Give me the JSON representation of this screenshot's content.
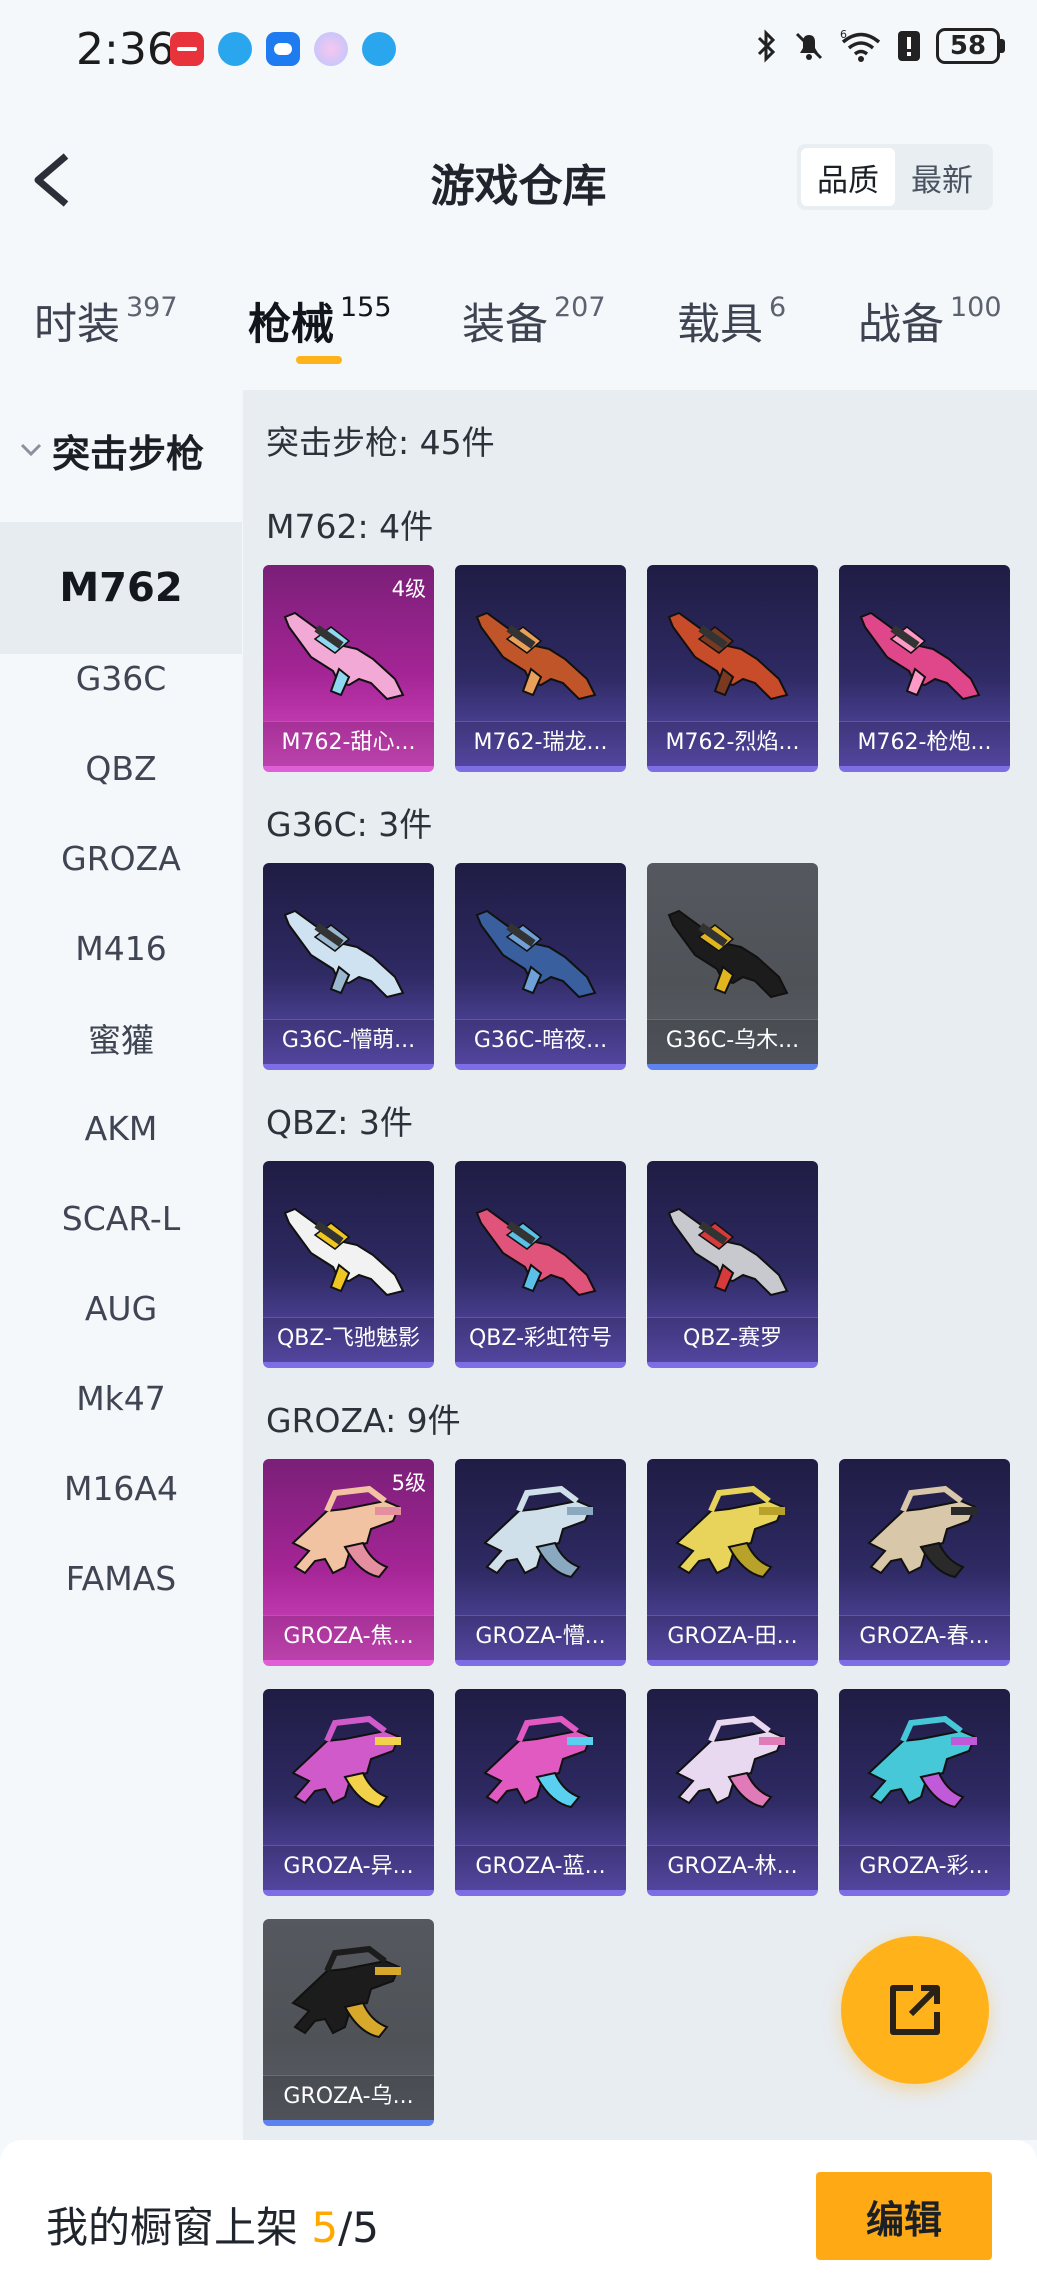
{
  "status_bar": {
    "time": "2:36",
    "battery": "58",
    "app_icons": [
      "huawei-store-icon",
      "browser-icon",
      "weather-icon",
      "assistant-icon",
      "browser-icon"
    ]
  },
  "header": {
    "title": "游戏仓库",
    "sort_options": [
      "品质",
      "最新"
    ],
    "sort_active": "品质"
  },
  "tabs": [
    {
      "label": "时装",
      "count": "397"
    },
    {
      "label": "枪械",
      "count": "155",
      "active": true
    },
    {
      "label": "装备",
      "count": "207"
    },
    {
      "label": "载具",
      "count": "6"
    },
    {
      "label": "战备",
      "count": "100"
    }
  ],
  "sidebar": {
    "group": "突击步枪",
    "items": [
      "M762",
      "G36C",
      "QBZ",
      "GROZA",
      "M416",
      "蜜獾",
      "AKM",
      "SCAR-L",
      "AUG",
      "Mk47",
      "M16A4",
      "FAMAS"
    ],
    "active": "M762"
  },
  "main": {
    "total": "突击步枪: 45件",
    "sections": [
      {
        "title": "M762: 4件",
        "items": [
          {
            "name": "M762-甜心...",
            "rarity": "pink",
            "level": "4级",
            "colors": [
              "#f3a9d6",
              "#8fd9f0"
            ]
          },
          {
            "name": "M762-瑞龙...",
            "rarity": "purple",
            "colors": [
              "#c0552a",
              "#e8a05a"
            ]
          },
          {
            "name": "M762-烈焰...",
            "rarity": "purple",
            "colors": [
              "#c84b2a",
              "#7a3a22"
            ]
          },
          {
            "name": "M762-枪炮...",
            "rarity": "purple",
            "colors": [
              "#e0478a",
              "#ff9ac8"
            ]
          }
        ]
      },
      {
        "title": "G36C: 3件",
        "items": [
          {
            "name": "G36C-懵萌...",
            "rarity": "purple",
            "colors": [
              "#cfe2f2",
              "#9ab8d0"
            ]
          },
          {
            "name": "G36C-暗夜...",
            "rarity": "purple",
            "colors": [
              "#3a5f9e",
              "#6fa0d8"
            ]
          },
          {
            "name": "G36C-乌木...",
            "rarity": "gray",
            "colors": [
              "#1c1c1c",
              "#e2b51e"
            ]
          }
        ]
      },
      {
        "title": "QBZ: 3件",
        "items": [
          {
            "name": "QBZ-飞驰魅影",
            "rarity": "purple",
            "colors": [
              "#f2f2f2",
              "#f0c722"
            ]
          },
          {
            "name": "QBZ-彩虹符号",
            "rarity": "purple",
            "colors": [
              "#e0537a",
              "#5bc0e8"
            ]
          },
          {
            "name": "QBZ-赛罗",
            "rarity": "purple",
            "colors": [
              "#c7c9cf",
              "#d63a3a"
            ]
          }
        ]
      },
      {
        "title": "GROZA: 9件",
        "items": [
          {
            "name": "GROZA-焦...",
            "rarity": "pink",
            "level": "5级",
            "colors": [
              "#f2c3a2",
              "#e48fa0"
            ]
          },
          {
            "name": "GROZA-懵...",
            "rarity": "purple",
            "colors": [
              "#cfe0ea",
              "#8aa9c0"
            ]
          },
          {
            "name": "GROZA-田...",
            "rarity": "purple",
            "colors": [
              "#e8d45a",
              "#b8a22a"
            ]
          },
          {
            "name": "GROZA-春...",
            "rarity": "purple",
            "colors": [
              "#d8c7a8",
              "#2a2a2a"
            ]
          },
          {
            "name": "GROZA-异...",
            "rarity": "purple",
            "colors": [
              "#d05ac9",
              "#f2d24a"
            ]
          },
          {
            "name": "GROZA-蓝...",
            "rarity": "purple",
            "colors": [
              "#e05ac2",
              "#5ad0f0"
            ]
          },
          {
            "name": "GROZA-林...",
            "rarity": "purple",
            "colors": [
              "#e8d8f0",
              "#e07ab8"
            ]
          },
          {
            "name": "GROZA-彩...",
            "rarity": "purple",
            "colors": [
              "#47c8d8",
              "#c05ad8"
            ]
          },
          {
            "name": "GROZA-乌...",
            "rarity": "gray",
            "colors": [
              "#1c1c1c",
              "#d8a82a"
            ]
          }
        ]
      }
    ]
  },
  "bottom": {
    "label": "我的橱窗上架",
    "current": "5",
    "sep_total": "/5",
    "edit_label": "编辑"
  },
  "colors": {
    "accent": "#ffaa14",
    "purple_border": "#7d6ee6",
    "pink_border": "#e05fd6",
    "gray_border": "#5d83f0"
  }
}
